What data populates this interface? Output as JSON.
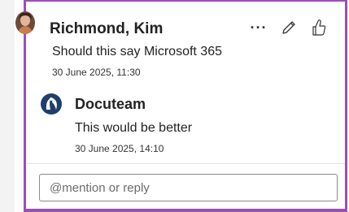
{
  "comment": {
    "author": "Richmond, Kim",
    "text": "Should this say Microsoft 365",
    "timestamp": "30 June 2025, 11:30",
    "actions": {
      "more_label": "···",
      "more_icon": "more-options-icon",
      "edit_icon": "pencil-edit-icon",
      "like_icon": "thumbs-up-icon"
    },
    "avatar_icon": "user-photo-avatar"
  },
  "reply": {
    "author": "Docuteam",
    "text": "This would be better",
    "timestamp": "30 June 2025, 14:10",
    "avatar_icon": "docuteam-logo-avatar"
  },
  "reply_box": {
    "placeholder": "@mention or reply",
    "value": ""
  },
  "colors": {
    "accent": "#9b4fb6",
    "input_border": "#8a8a8a",
    "text": "#222222"
  }
}
